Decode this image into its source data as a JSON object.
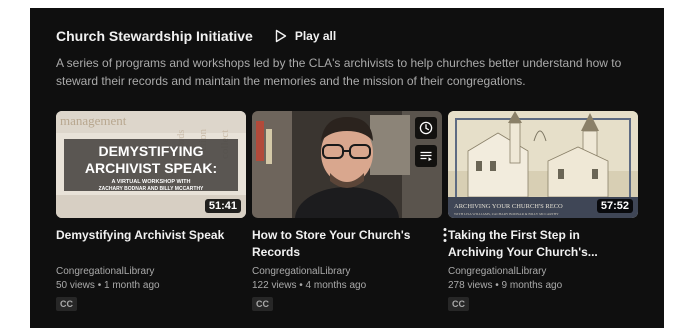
{
  "shelf": {
    "title": "Church Stewardship Initiative",
    "play_all_label": "Play all",
    "description": "A series of programs and workshops led by the CLA's archivists to help churches better understand how to steward their records and maintain the memories and the mission of their congregations."
  },
  "videos": [
    {
      "title": "Demystifying Archivist Speak",
      "channel": "CongregationalLibrary",
      "views": "50 views",
      "age": "1 month ago",
      "duration": "51:41",
      "badge": "CC",
      "thumbnail": {
        "line1": "DEMYSTIFYING",
        "line2": "ARCHIVIST SPEAK:",
        "line3": "A VIRTUAL WORKSHOP WITH",
        "line4": "ZACHARY BODNAR AND BILLY MCCARTHY",
        "bg_words": "management"
      }
    },
    {
      "title": "How to Store Your Church's Records",
      "channel": "CongregationalLibrary",
      "views": "122 views",
      "age": "4 months ago",
      "badge": "CC"
    },
    {
      "title": "Taking the First Step in Archiving Your Church's...",
      "channel": "CongregationalLibrary",
      "views": "278 views",
      "age": "9 months ago",
      "duration": "57:52",
      "badge": "CC",
      "thumbnail": {
        "caption": "ARCHIVING YOUR CHURCH'S RECO"
      }
    }
  ],
  "meta_separator": "•",
  "colors": {
    "background": "#0f0f0f",
    "title_text": "#f1f1f1",
    "secondary_text": "#aaaaaa",
    "badge_bg": "#272727"
  },
  "icons": {
    "play_all": "play-outline-icon",
    "watch_later": "clock-icon",
    "add_to_queue": "queue-icon",
    "menu": "vertical-dots-icon"
  }
}
